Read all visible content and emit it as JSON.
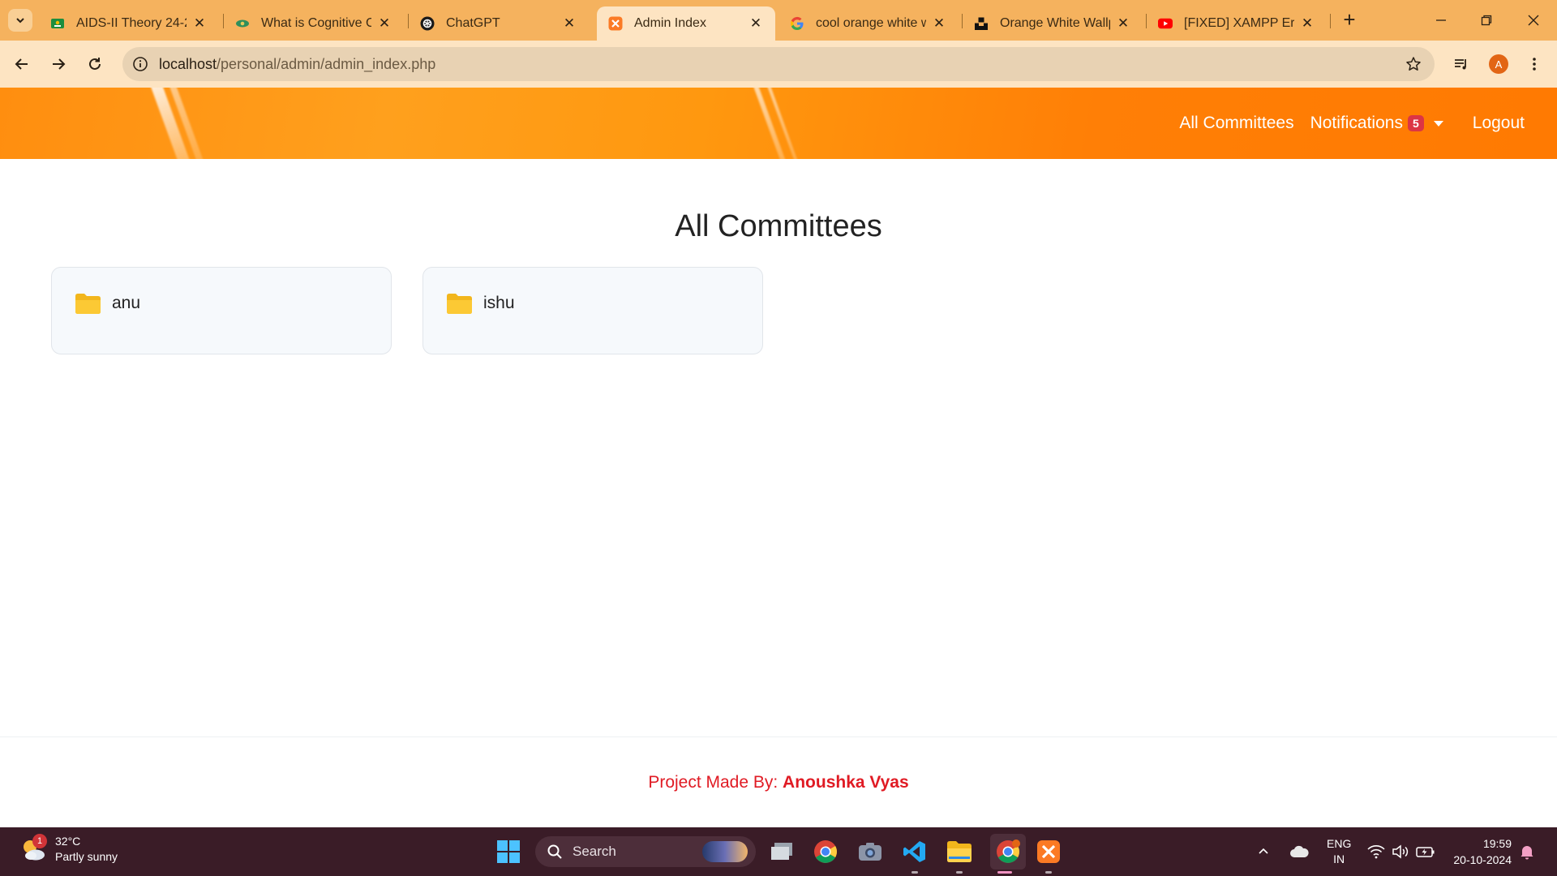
{
  "browser": {
    "tabs": [
      {
        "title": "AIDS-II Theory 24-25",
        "icon": "classroom-icon"
      },
      {
        "title": "What is Cognitive Co",
        "icon": "eye-favicon-icon"
      },
      {
        "title": "ChatGPT",
        "icon": "chatgpt-icon"
      },
      {
        "title": "Admin Index",
        "icon": "xampp-icon",
        "active": true
      },
      {
        "title": "cool orange white w",
        "icon": "google-icon"
      },
      {
        "title": "Orange White Wallp",
        "icon": "unsplash-icon"
      },
      {
        "title": "[FIXED] XAMPP Error",
        "icon": "youtube-icon"
      }
    ],
    "url_host": "localhost",
    "url_path": "/personal/admin/admin_index.php",
    "profile_initial": "A"
  },
  "header": {
    "nav": {
      "all_committees": "All Committees",
      "notifications": "Notifications",
      "notifications_count": "5",
      "logout": "Logout"
    }
  },
  "main": {
    "title": "All Committees",
    "committees": [
      {
        "name": "anu"
      },
      {
        "name": "ishu"
      }
    ]
  },
  "footer": {
    "prefix": "Project Made By: ",
    "author": "Anoushka Vyas"
  },
  "taskbar": {
    "weather_badge": "1",
    "temperature": "32°C",
    "condition": "Partly sunny",
    "search_placeholder": "Search",
    "language": "ENG",
    "region": "IN",
    "time": "19:59",
    "date": "20-10-2024"
  },
  "colors": {
    "header_orange": "#ff8c0a",
    "footer_red": "#e01b24",
    "badge_red": "#dc3545",
    "folder_yellow": "#f7c325"
  }
}
